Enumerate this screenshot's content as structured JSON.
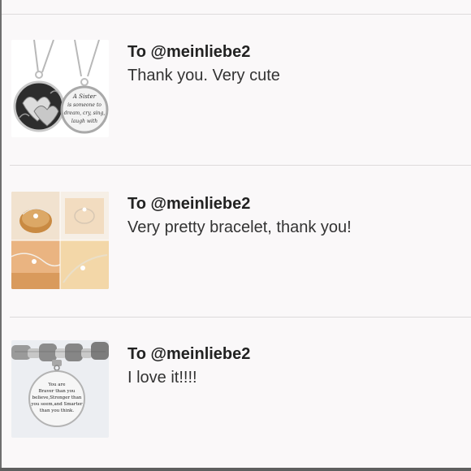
{
  "reviews": [
    {
      "recipient": "To @meinliebe2",
      "comment": "Thank you. Very cute",
      "image": {
        "icon": "sister-necklace-image",
        "engraving": [
          "A Sister",
          "is someone to",
          "dream, cry, sing,",
          "laugh with"
        ]
      }
    },
    {
      "recipient": "To @meinliebe2",
      "comment": "Very pretty bracelet, thank you!",
      "image": {
        "icon": "bracelet-collage-image"
      }
    },
    {
      "recipient": "To @meinliebe2",
      "comment": "I love it!!!!",
      "image": {
        "icon": "charm-bracelet-image",
        "engraving": [
          "You are",
          "Braver than you",
          "believe,Stronger than",
          "you seem,and Smarter",
          "than you think."
        ]
      }
    }
  ],
  "colors": {
    "background": "#faf8f9",
    "divider": "#dddadb",
    "recipient_text": "#222222",
    "comment_text": "#333333"
  }
}
